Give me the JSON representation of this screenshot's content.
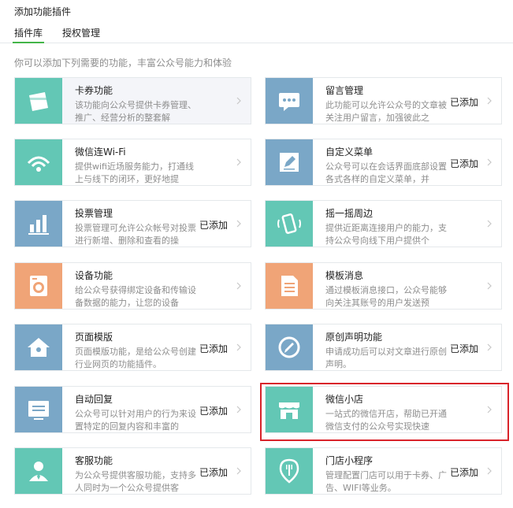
{
  "page_title": "添加功能插件",
  "tabs": [
    {
      "label": "插件库",
      "active": true
    },
    {
      "label": "授权管理",
      "active": false
    }
  ],
  "intro": "你可以添加下列需要的功能，丰富公众号能力和体验",
  "colors": {
    "accent": "#44b549",
    "highlight_border": "#d9232a"
  },
  "plugins": [
    {
      "name": "卡券功能",
      "desc": "该功能向公众号提供卡券管理、推广、经营分析的整套解",
      "status": "",
      "icon": "card-icon",
      "color": "#63c7b5"
    },
    {
      "name": "留言管理",
      "desc": "此功能可以允许公众号的文章被关注用户留言，加强彼此之",
      "status": "已添加",
      "icon": "comment-icon",
      "color": "#7aa7c7"
    },
    {
      "name": "微信连Wi-Fi",
      "desc": "提供wifi近场服务能力，打通线上与线下的闭环，更好地提",
      "status": "",
      "icon": "wifi-icon",
      "color": "#63c7b5"
    },
    {
      "name": "自定义菜单",
      "desc": "公众号可以在会话界面底部设置各式各样的自定义菜单，并",
      "status": "已添加",
      "icon": "edit-icon",
      "color": "#7aa7c7"
    },
    {
      "name": "投票管理",
      "desc": "投票管理可允许公众帐号对投票进行新增、删除和查看的操",
      "status": "已添加",
      "icon": "bar-chart-icon",
      "color": "#7aa7c7"
    },
    {
      "name": "摇一摇周边",
      "desc": "提供近距离连接用户的能力，支持公众号向线下用户提供个",
      "status": "",
      "icon": "shake-phone-icon",
      "color": "#63c7b5"
    },
    {
      "name": "设备功能",
      "desc": "给公众号获得绑定设备和传输设备数据的能力，让您的设备",
      "status": "",
      "icon": "device-icon",
      "color": "#f0a477"
    },
    {
      "name": "模板消息",
      "desc": "通过模板消息接口，公众号能够向关注其账号的用户发送预",
      "status": "",
      "icon": "template-doc-icon",
      "color": "#f0a477"
    },
    {
      "name": "页面模版",
      "desc": "页面模版功能，是给公众号创建行业网页的功能插件。",
      "status": "已添加",
      "icon": "home-icon",
      "color": "#7aa7c7"
    },
    {
      "name": "原创声明功能",
      "desc": "申请成功后可以对文章进行原创声明。",
      "status": "已添加",
      "icon": "original-pen-icon",
      "color": "#7aa7c7"
    },
    {
      "name": "自动回复",
      "desc": "公众号可以针对用户的行为来设置特定的回复内容和丰富的",
      "status": "已添加",
      "icon": "auto-reply-icon",
      "color": "#7aa7c7"
    },
    {
      "name": "微信小店",
      "desc": "一站式的微信开店，帮助已开通微信支付的公众号实现快速",
      "status": "",
      "icon": "store-icon",
      "color": "#63c7b5"
    },
    {
      "name": "客服功能",
      "desc": "为公众号提供客服功能，支持多人同时为一个公众号提供客",
      "status": "已添加",
      "icon": "customer-service-icon",
      "color": "#63c7b5"
    },
    {
      "name": "门店小程序",
      "desc": "管理配置门店可以用于卡券、广告、WIFI等业务。",
      "status": "已添加",
      "icon": "location-fork-icon",
      "color": "#63c7b5"
    }
  ]
}
